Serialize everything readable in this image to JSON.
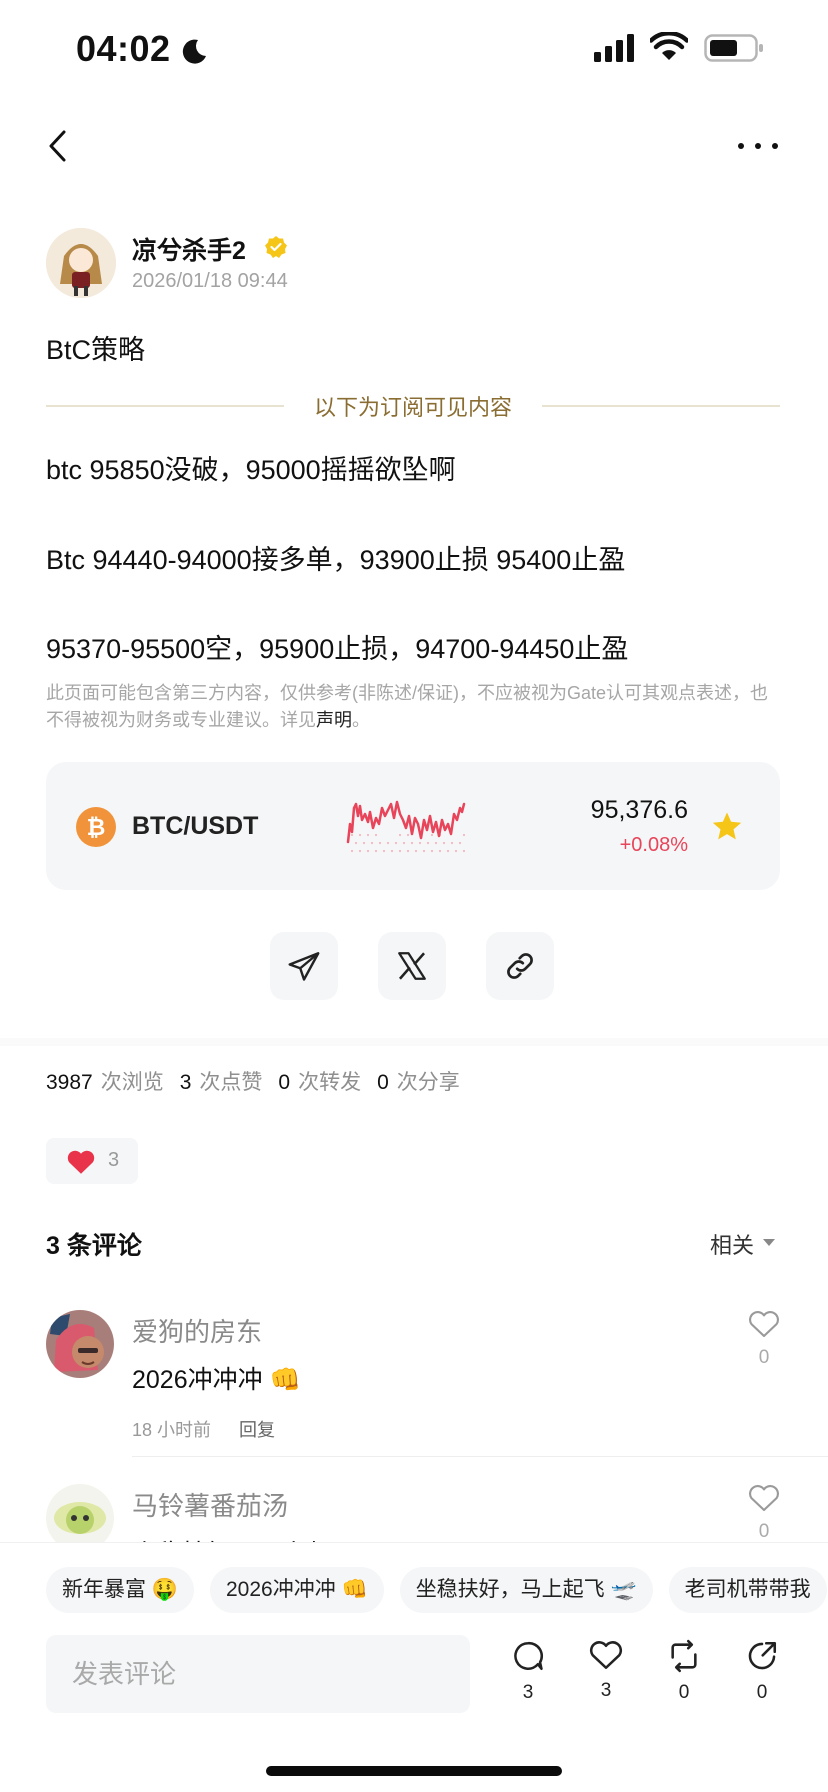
{
  "status_bar": {
    "time": "04:02"
  },
  "author": {
    "name": "凉兮杀手2",
    "date": "2026/01/18 09:44"
  },
  "post": {
    "title": "BtC策略",
    "subscription_label": "以下为订阅可见内容",
    "lines": [
      "btc 95850没破，95000摇摇欲坠啊",
      "Btc 94440-94000接多单，93900止损 95400止盈",
      "95370-95500空，95900止损，94700-94450止盈"
    ],
    "disclaimer": "此页面可能包含第三方内容，仅供参考(非陈述/保证)，不应被视为Gate认可其观点表述，也不得被视为财务或专业建议。详见",
    "disclaimer_link": "声明",
    "disclaimer_end": "。"
  },
  "ticker": {
    "pair": "BTC/USDT",
    "price": "95,376.6",
    "change": "+0.08%",
    "colors": {
      "up": "#e8445a",
      "star": "#f5c518",
      "coin": "#f0933a"
    }
  },
  "share_icons": [
    "telegram-icon",
    "x-icon",
    "link-icon"
  ],
  "stats": [
    {
      "value": "3987",
      "label": "次浏览"
    },
    {
      "value": "3",
      "label": "次点赞"
    },
    {
      "value": "0",
      "label": "次转发"
    },
    {
      "value": "0",
      "label": "次分享"
    }
  ],
  "reaction": {
    "count": "3"
  },
  "comments_header": {
    "title": "3 条评论",
    "sort": "相关"
  },
  "comments": [
    {
      "name": "爱狗的房东",
      "text": "2026冲冲冲 👊",
      "time": "18 小时前",
      "reply": "回复",
      "likes": "0"
    },
    {
      "name": "马铃薯番茄汤",
      "text": "坐稳扶好，马上起飞",
      "likes": "0"
    }
  ],
  "quick_replies": [
    "新年暴富 🤑",
    "2026冲冲冲 👊",
    "坐稳扶好，马上起飞 🛫",
    "老司机带带我"
  ],
  "bottom_bar": {
    "placeholder": "发表评论",
    "actions": [
      {
        "icon": "comment-icon",
        "count": "3"
      },
      {
        "icon": "heart-icon",
        "count": "3"
      },
      {
        "icon": "repost-icon",
        "count": "0"
      },
      {
        "icon": "share-icon",
        "count": "0"
      }
    ]
  }
}
